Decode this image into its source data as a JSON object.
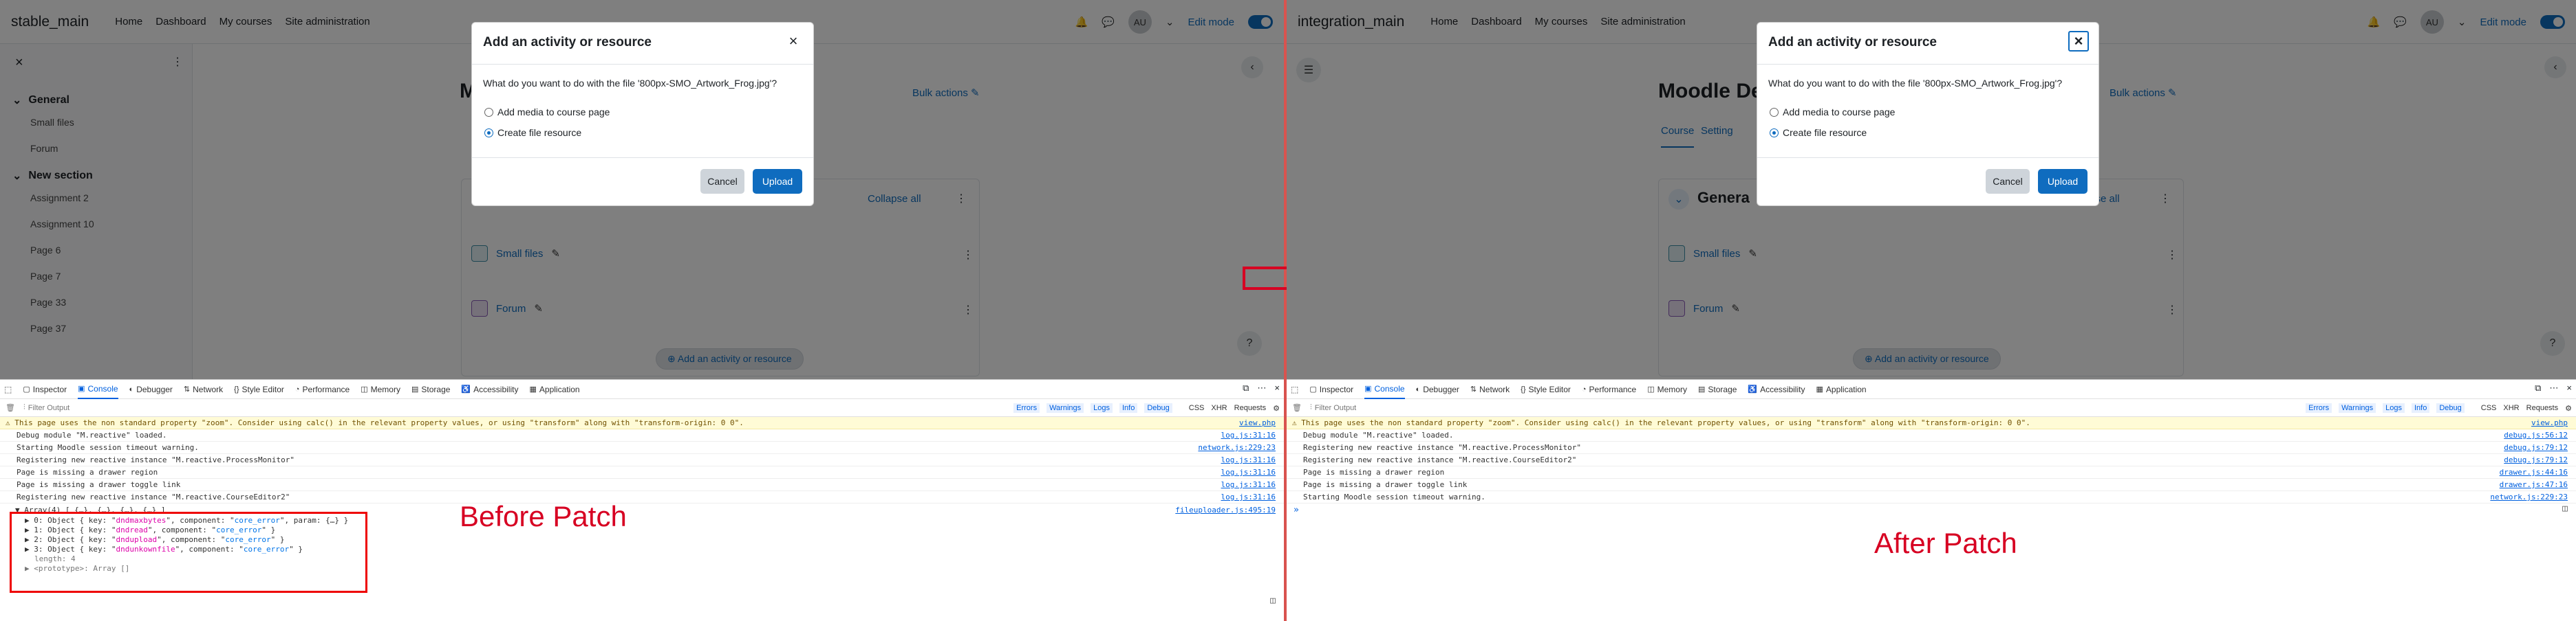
{
  "left": {
    "site_name": "stable_main",
    "nav": [
      "Home",
      "Dashboard",
      "My courses",
      "Site administration"
    ],
    "avatar": "AU",
    "edit_mode": "Edit mode",
    "drawer": {
      "sections": [
        {
          "title": "General",
          "items": [
            "Small files",
            "Forum"
          ]
        },
        {
          "title": "New section",
          "items": [
            "Assignment 2",
            "Assignment 10",
            "Page 6",
            "Page 7",
            "Page 33",
            "Page 37"
          ]
        }
      ]
    },
    "course_title_partial": "M",
    "bulk_actions": "Bulk actions",
    "collapse_all": "Collapse all",
    "activities": [
      "Small files",
      "Forum"
    ],
    "add_activity": "Add an activity or resource",
    "help": "?"
  },
  "right": {
    "site_name": "integration_main",
    "nav": [
      "Home",
      "Dashboard",
      "My courses",
      "Site administration"
    ],
    "avatar": "AU",
    "edit_mode": "Edit mode",
    "course_title_partial": "Moodle De",
    "course_tabs": [
      "Course",
      "Setting"
    ],
    "section_title_partial": "Genera",
    "bulk_actions": "Bulk actions",
    "collapse_all": "Collapse all",
    "activities": [
      "Small files",
      "Forum"
    ],
    "add_activity": "Add an activity or resource",
    "help": "?"
  },
  "modal": {
    "title": "Add an activity or resource",
    "close": "×",
    "question": "What do you want to do with the file '800px-SMO_Artwork_Frog.jpg'?",
    "options": [
      "Add media to course page",
      "Create file resource"
    ],
    "selected_index": 1,
    "cancel": "Cancel",
    "upload": "Upload"
  },
  "devtools": {
    "tabs": [
      "Inspector",
      "Console",
      "Debugger",
      "Network",
      "Style Editor",
      "Performance",
      "Memory",
      "Storage",
      "Accessibility",
      "Application"
    ],
    "active_tab": "Console",
    "filter_placeholder": "Filter Output",
    "filters": [
      "Errors",
      "Warnings",
      "Logs",
      "Info",
      "Debug"
    ],
    "extra_filters": [
      "CSS",
      "XHR",
      "Requests"
    ],
    "warning": "This page uses the non standard property \"zoom\". Consider using calc() in the relevant property values, or using \"transform\" along with \"transform-origin: 0 0\".",
    "warning_src": "view.php"
  },
  "left_console": {
    "rows": [
      {
        "text": "Debug module \"M.reactive\" loaded.",
        "src": "log.js:31:16"
      },
      {
        "text": "Starting Moodle session timeout warning.",
        "src": "network.js:229:23"
      },
      {
        "text": "Registering new reactive instance \"M.reactive.ProcessMonitor\"",
        "src": "log.js:31:16"
      },
      {
        "text": "Page is missing a drawer region",
        "src": "log.js:31:16"
      },
      {
        "text": "Page is missing a drawer toggle link",
        "src": "log.js:31:16"
      },
      {
        "text": "Registering new reactive instance \"M.reactive.CourseEditor2\"",
        "src": "log.js:31:16"
      }
    ],
    "array_header": "▼ Array(4) [ {…}, {…}, {…}, {…} ]",
    "array_src": "fileuploader.js:495:19",
    "array_items": [
      {
        "idx": "0",
        "key": "dndmaxbytes",
        "component": "core_error",
        "extra": ", param: {…} }"
      },
      {
        "idx": "1",
        "key": "dndread",
        "component": "core_error",
        "extra": " }"
      },
      {
        "idx": "2",
        "key": "dndupload",
        "component": "core_error",
        "extra": " }"
      },
      {
        "idx": "3",
        "key": "dndunkownfile",
        "component": "core_error",
        "extra": " }"
      }
    ],
    "length_line": "length: 4",
    "prototype_line": "▶ <prototype>: Array []",
    "annotation": "Before Patch"
  },
  "right_console": {
    "rows": [
      {
        "text": "Debug module \"M.reactive\" loaded.",
        "src": "debug.js:56:12"
      },
      {
        "text": "Registering new reactive instance \"M.reactive.ProcessMonitor\"",
        "src": "debug.js:79:12"
      },
      {
        "text": "Registering new reactive instance \"M.reactive.CourseEditor2\"",
        "src": "debug.js:79:12"
      },
      {
        "text": "Page is missing a drawer region",
        "src": "drawer.js:44:16"
      },
      {
        "text": "Page is missing a drawer toggle link",
        "src": "drawer.js:47:16"
      },
      {
        "text": "Starting Moodle session timeout warning.",
        "src": "network.js:229:23"
      }
    ],
    "annotation": "After Patch"
  }
}
